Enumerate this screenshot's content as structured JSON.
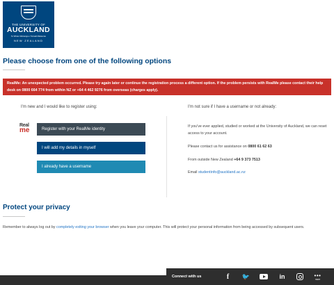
{
  "logo": {
    "line1": "THE UNIVERSITY OF",
    "line2": "AUCKLAND",
    "line3": "Te Whare Wānanga o Tāmaki Makaurau",
    "line4": "NEW ZEALAND"
  },
  "heading": "Please choose from one of the following options",
  "alert": {
    "text": "RealMe: An unexpected problem occurred. Please try again later or continue the registration process a different option. If the problem persists with RealMe please contact their help desk on 0800 664 774 from within NZ or +64 4 462 9276 from overseas (charges apply)."
  },
  "left": {
    "heading": "I'm new and I would like to register using:",
    "realme_logo": {
      "top": "Real",
      "bottom": "me"
    },
    "buttons": {
      "realme": "Register with your RealMe identity",
      "details": "I will add my details in myself",
      "username": "I already have a username"
    }
  },
  "right": {
    "heading": "I'm not sure if I have a username or not already:",
    "para1": "If you've ever applied, studied or worked at the University of Auckland, we can reset access to your account.",
    "contact_prefix": "Please contact us for assistance on ",
    "contact_phone": "0800 61 62 63",
    "outside_prefix": "From outside New Zealand ",
    "outside_phone": "+64 9 373 7513",
    "email_prefix": "Email ",
    "email": "studentinfo@auckland.ac.nz"
  },
  "privacy": {
    "heading": "Protect your privacy",
    "text_before": "Remember to always log out by ",
    "link": "completely exiting your browser",
    "text_after": " when you leave your computer. This will protect your personal information from being accessed by subsequent users."
  },
  "footer": {
    "connect_label": "Connect with us",
    "facebook": "f",
    "twitter": "🐦",
    "linkedin": "in",
    "more_dots": "•••",
    "more_label": "more"
  },
  "colors": {
    "brand_blue": "#00467f",
    "alert_red": "#c8312a",
    "button_dark": "#3c4a55",
    "button_light": "#1f8ab3",
    "link": "#1f72c4",
    "footer": "#2e2e2e"
  }
}
